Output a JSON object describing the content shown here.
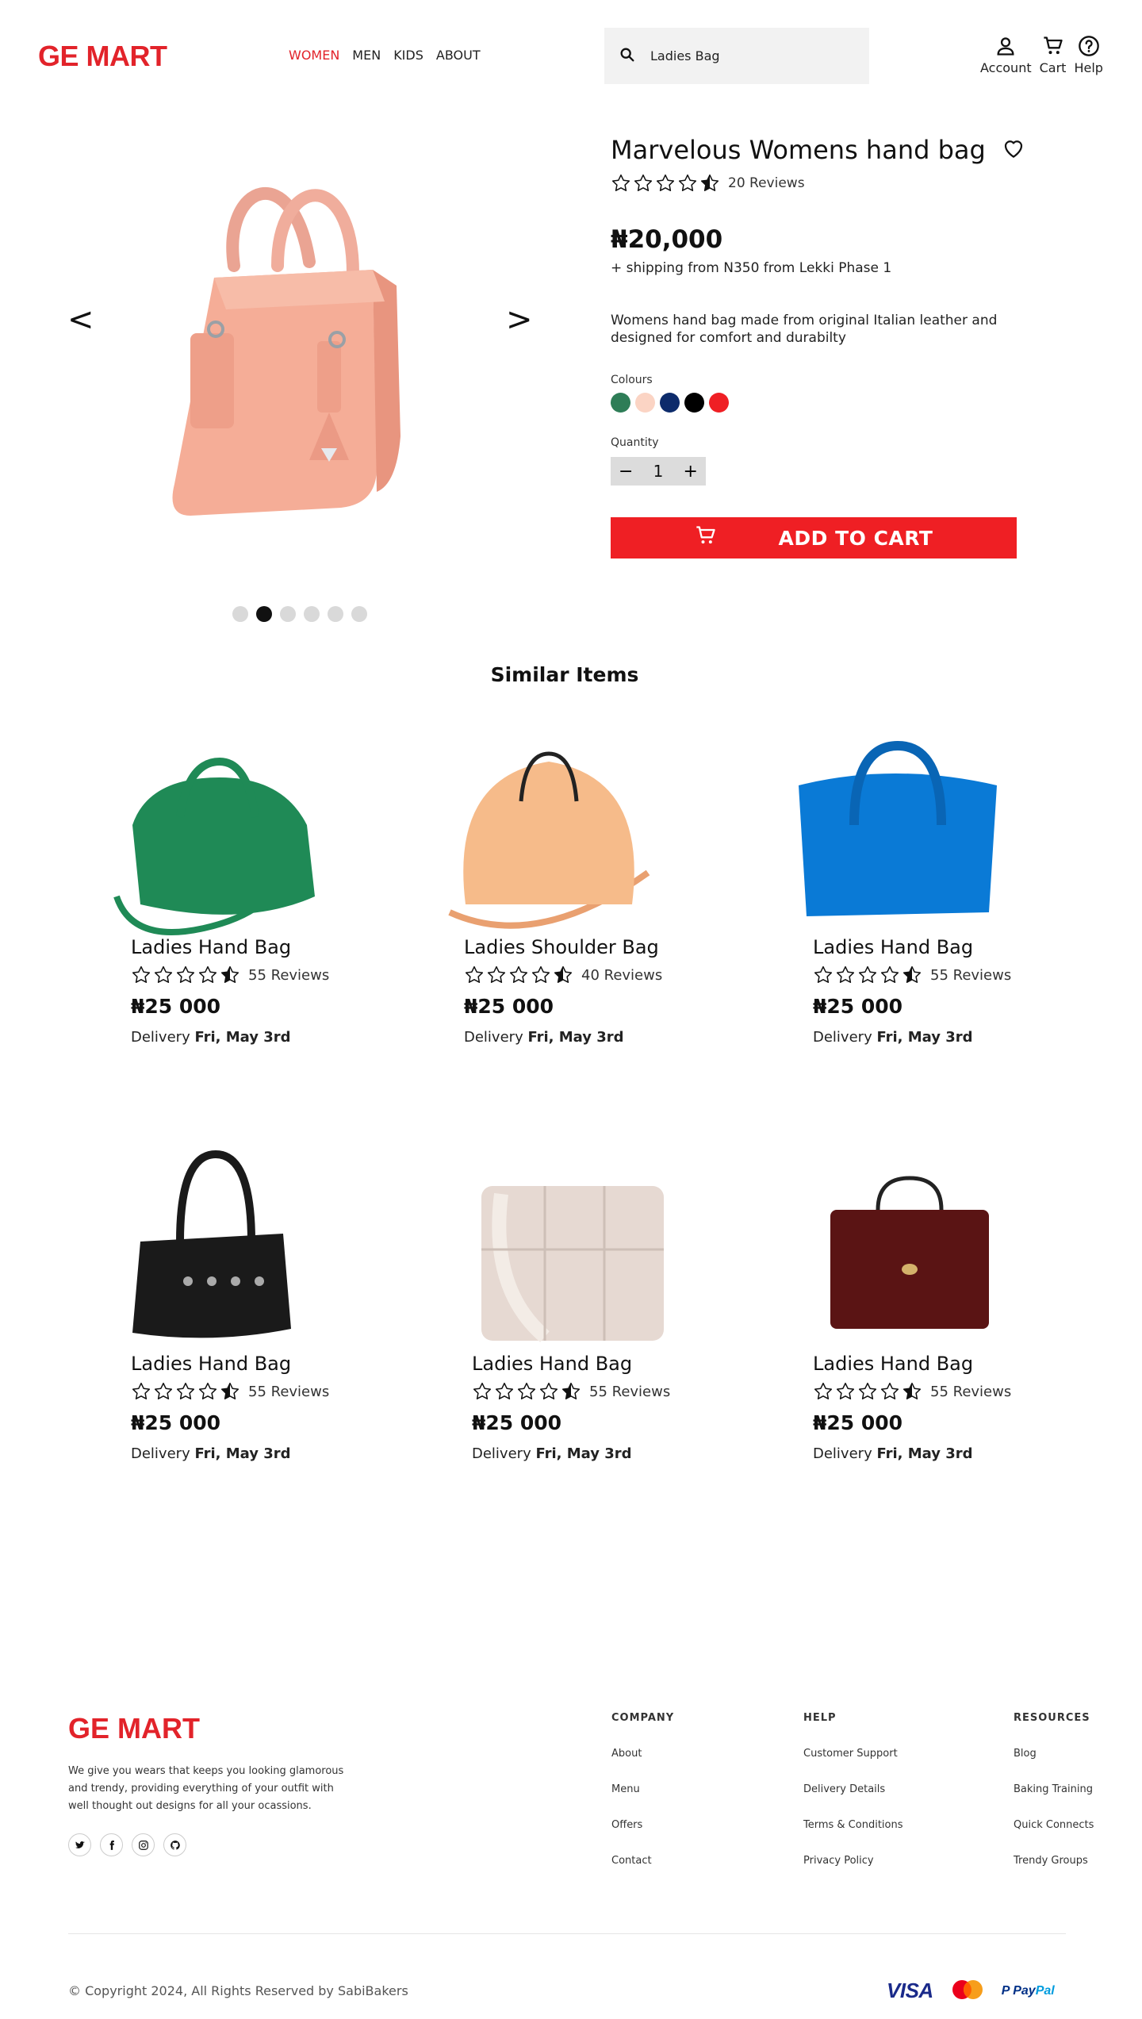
{
  "header": {
    "logo": "GE MART",
    "nav": [
      "WOMEN",
      "MEN",
      "KIDS",
      "ABOUT"
    ],
    "search_value": "Ladies Bag",
    "utils": {
      "account": "Account",
      "cart": "Cart",
      "help": "Help"
    }
  },
  "product": {
    "title": "Marvelous Womens hand bag",
    "reviews": "20 Reviews",
    "price": "₦20,000",
    "shipping": "+ shipping from N350 from Lekki Phase 1",
    "description": "Womens hand bag made from original Italian leather and designed for comfort and durabilty",
    "colours_label": "Colours",
    "colours": [
      "#2e7d57",
      "#fbd4c4",
      "#0d2b6b",
      "#000000",
      "#ef1f24"
    ],
    "quantity_label": "Quantity",
    "quantity": "1",
    "add_to_cart": "ADD TO CART",
    "prev_arrow": "<",
    "next_arrow": ">",
    "dots_active_index": 1,
    "rating": 4.5
  },
  "similar": {
    "title": "Similar Items",
    "items": [
      {
        "name": "Ladies Hand Bag",
        "reviews": "55 Reviews",
        "price": "₦25 000",
        "delivery_prefix": "Delivery",
        "delivery_date": "Fri, May 3rd",
        "color": "#1f8a56"
      },
      {
        "name": "Ladies Shoulder Bag",
        "reviews": "40 Reviews",
        "price": "₦25 000",
        "delivery_prefix": "Delivery",
        "delivery_date": "Fri, May 3rd",
        "color": "#f6bb8a"
      },
      {
        "name": "Ladies Hand Bag",
        "reviews": "55 Reviews",
        "price": "₦25 000",
        "delivery_prefix": "Delivery",
        "delivery_date": "Fri, May 3rd",
        "color": "#0a7ad6"
      },
      {
        "name": "Ladies Hand Bag",
        "reviews": "55 Reviews",
        "price": "₦25 000",
        "delivery_prefix": "Delivery",
        "delivery_date": "Fri, May 3rd",
        "color": "#1a1a1a"
      },
      {
        "name": "Ladies Hand Bag",
        "reviews": "55 Reviews",
        "price": "₦25 000",
        "delivery_prefix": "Delivery",
        "delivery_date": "Fri, May 3rd",
        "color": "#e6d9d2"
      },
      {
        "name": "Ladies Hand Bag",
        "reviews": "55 Reviews",
        "price": "₦25 000",
        "delivery_prefix": "Delivery",
        "delivery_date": "Fri, May 3rd",
        "color": "#5a1414"
      }
    ]
  },
  "footer": {
    "logo": "GE MART",
    "description": "We give you wears that keeps you looking glamorous and trendy, providing everything of your outfit with well thought out designs for all your ocassions.",
    "columns": [
      {
        "title": "COMPANY",
        "links": [
          "About",
          "Menu",
          "Offers",
          "Contact"
        ]
      },
      {
        "title": "HELP",
        "links": [
          "Customer Support",
          "Delivery Details",
          "Terms & Conditions",
          "Privacy Policy"
        ]
      },
      {
        "title": "RESOURCES",
        "links": [
          "Blog",
          "Baking Training",
          "Quick Connects",
          "Trendy Groups"
        ]
      }
    ],
    "copyright": "© Copyright 2024, All Rights Reserved by SabiBakers",
    "payments": {
      "visa": "VISA",
      "mastercard": "MasterCard",
      "paypal_pay": "Pay",
      "paypal_pal": "Pal"
    }
  },
  "colors": {
    "brand_red": "#e2232a",
    "button_red": "#ef1f24"
  }
}
